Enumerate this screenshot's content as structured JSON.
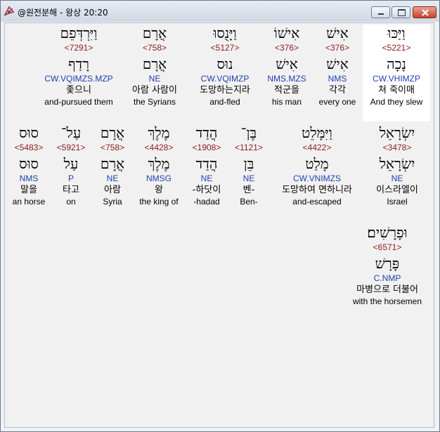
{
  "window": {
    "title": "@원전분해 - 왕상 20:20"
  },
  "rows": [
    [
      {
        "heb": "וַיַּכּוּ",
        "strong": "<5221>",
        "lemma": "נָכָה",
        "parse": "CW.VHIMZP",
        "kor": "쳐 죽이매",
        "eng": "And they slew",
        "highlight": true
      },
      {
        "heb": "אִישׁ",
        "strong": "<376>",
        "lemma": "אִישׁ",
        "parse": "NMS",
        "kor": "각각",
        "eng": "every one"
      },
      {
        "heb": "אִישׁוֹ",
        "strong": "<376>",
        "lemma": "אִישׁ",
        "parse": "NMS.MZS",
        "kor": "적군을",
        "eng": "his man"
      },
      {
        "heb": "וַיָּנֻסוּ",
        "strong": "<5127>",
        "lemma": "נוּס",
        "parse": "CW.VQIMZP",
        "kor": "도망하는지라",
        "eng": "and-fled"
      },
      {
        "heb": "אֲרָם",
        "strong": "<758>",
        "lemma": "אֲרָם",
        "parse": "NE",
        "kor": "아람 사람이",
        "eng": "the Syrians"
      },
      {
        "heb": "וַיִּרְדְּפֵם",
        "strong": "<7291>",
        "lemma": "רָדַף",
        "parse": "CW.VQIMZS.MZP",
        "kor": "좇으니",
        "eng": "and-pursued them"
      }
    ],
    [
      {
        "heb": "יִשְׂרָאֵל",
        "strong": "<3478>",
        "lemma": "יִשְׂרָאֵל",
        "parse": "NE",
        "kor": "이스라엘이",
        "eng": "Israel"
      },
      {
        "heb": "וַיִּמָּלֵט",
        "strong": "<4422>",
        "lemma": "מָלַט",
        "parse": "CW.VNIMZS",
        "kor": "도망하여 면하니라",
        "eng": "and-escaped"
      },
      {
        "heb": "בֶּן־",
        "strong": "<1121>",
        "lemma": "בֵּן",
        "parse": "NE",
        "kor": "벤-",
        "eng": "Ben-"
      },
      {
        "heb": "הֲדַד",
        "strong": "<1908>",
        "lemma": "הֲדַד",
        "parse": "NE",
        "kor": "-하닷이",
        "eng": "-hadad"
      },
      {
        "heb": "מֶלֶךְ",
        "strong": "<4428>",
        "lemma": "מֶלֶךְ",
        "parse": "NMSG",
        "kor": "왕",
        "eng": "the king of"
      },
      {
        "heb": "אֲרָם",
        "strong": "<758>",
        "lemma": "אֲרָם",
        "parse": "NE",
        "kor": "아람",
        "eng": "Syria"
      },
      {
        "heb": "עַל־",
        "strong": "<5921>",
        "lemma": "עַל",
        "parse": "P",
        "kor": "타고",
        "eng": "on"
      },
      {
        "heb": "סוּס",
        "strong": "<5483>",
        "lemma": "סוּס",
        "parse": "NMS",
        "kor": "말을",
        "eng": "an horse"
      }
    ],
    [
      {
        "heb": "וּפָרָשִׁים׃",
        "strong": "<6571>",
        "lemma": "פָּרָשׁ",
        "parse": "C.NMP",
        "kor": "마병으로 더불어",
        "eng": "with the horsemen"
      }
    ]
  ],
  "colors": {
    "strong": "#8b1a1a",
    "parse": "#1f3fb0",
    "highlight": "#ffffff"
  }
}
